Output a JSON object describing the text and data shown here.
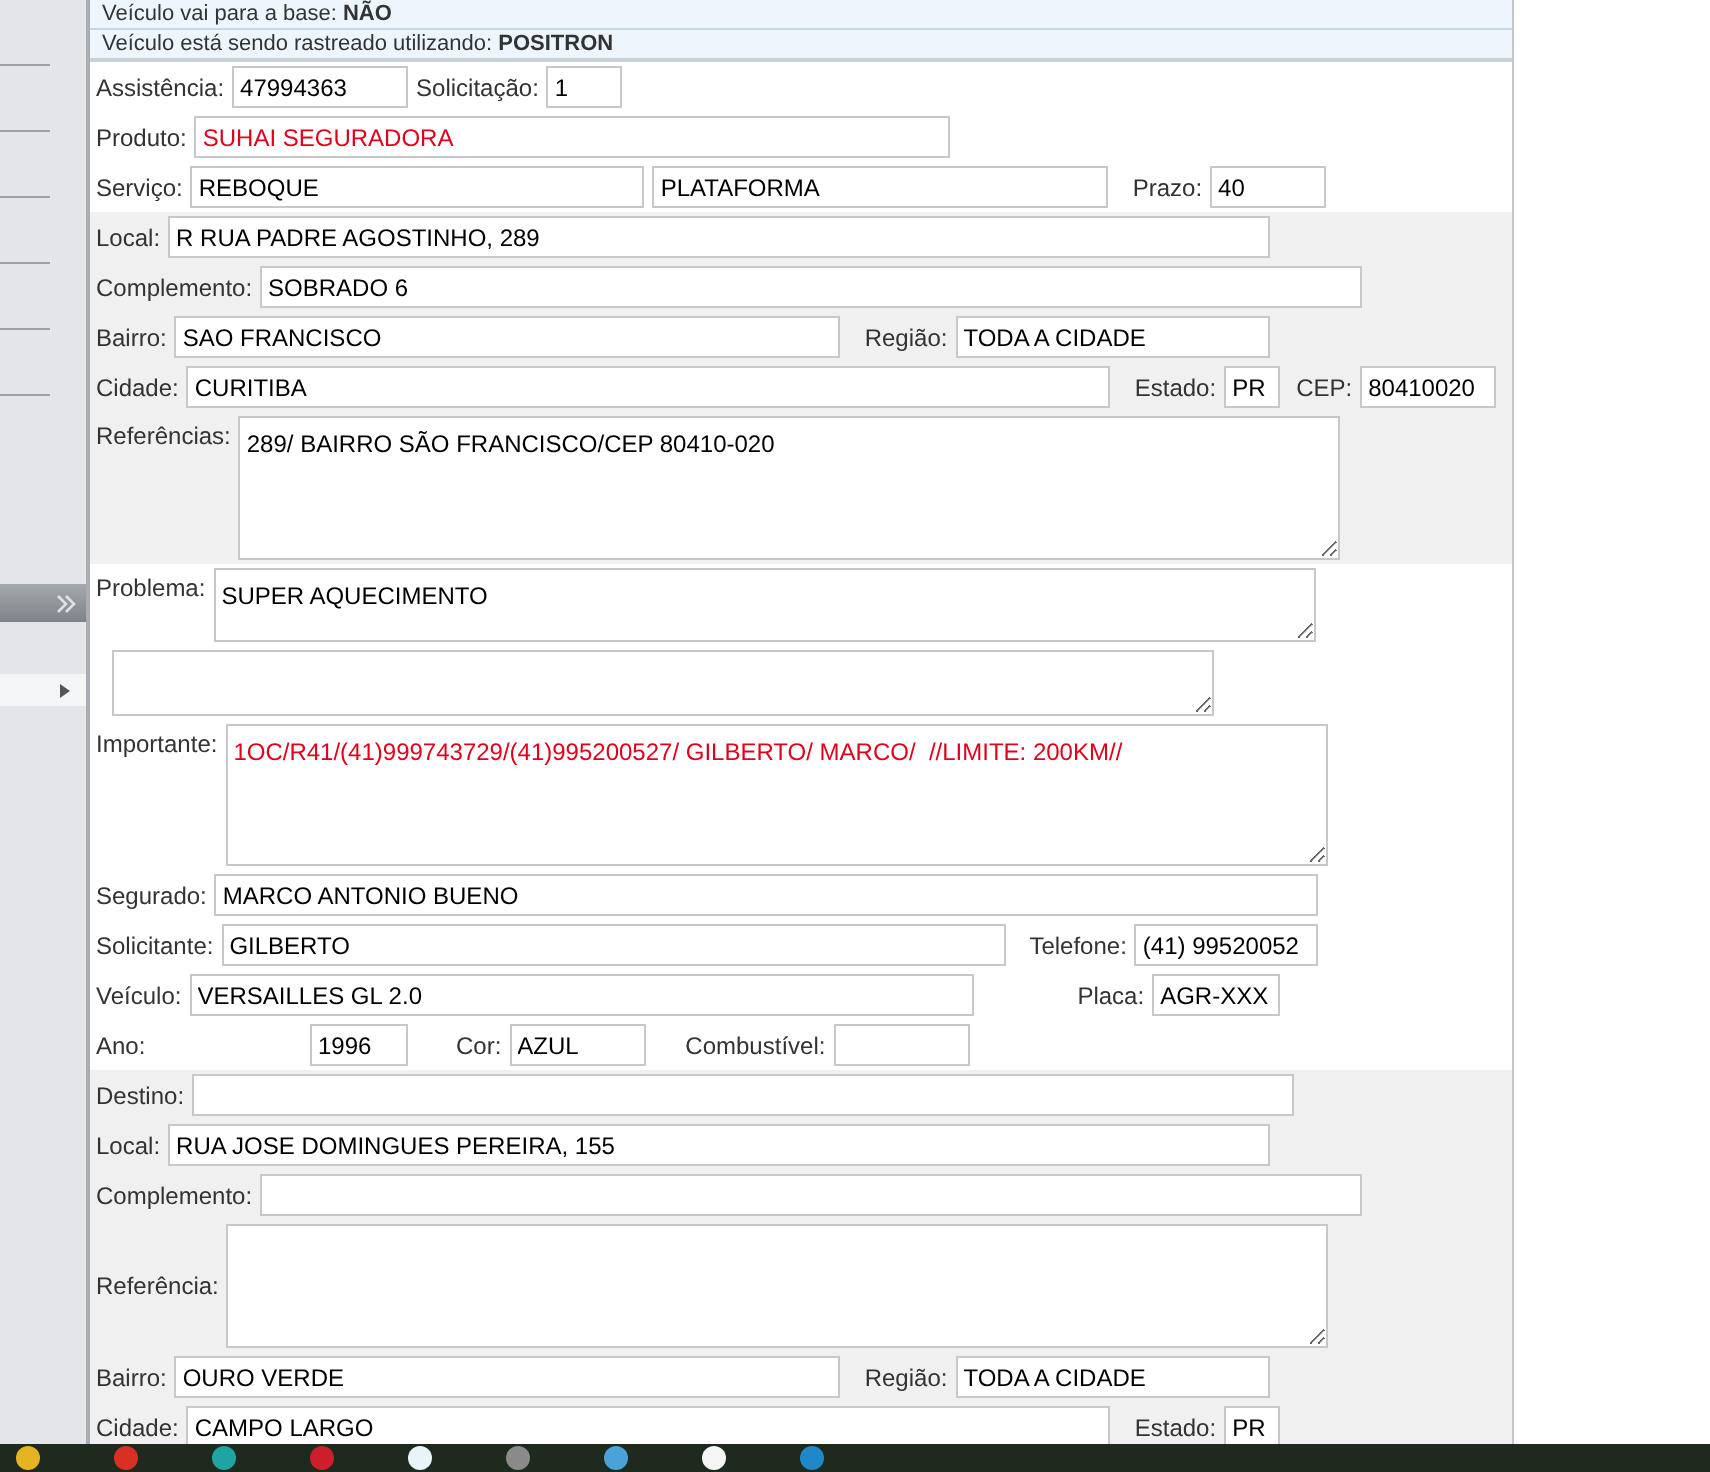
{
  "banners": [
    {
      "text": "Veículo vai para a base: **NÃO**"
    },
    {
      "text": "Veículo está sendo rastreado utilizando: **POSITRON**"
    }
  ],
  "sections": [
    {
      "shaded": false,
      "rows": [
        [
          {
            "label": "Assistência:",
            "value": "47994363",
            "kind": "input",
            "highlighted": false
          },
          {
            "label": "Solicitação:",
            "value": "1",
            "kind": "input",
            "highlighted": false
          }
        ],
        [
          {
            "label": "Produto:",
            "value": "SUHAI SEGURADORA",
            "kind": "input",
            "highlighted": true
          }
        ],
        [
          {
            "label": "Serviço:",
            "value": "REBOQUE",
            "kind": "input",
            "highlighted": false
          },
          {
            "value": "PLATAFORMA",
            "kind": "input",
            "highlighted": false
          },
          {
            "label": "Prazo:",
            "value": "40",
            "kind": "input",
            "highlighted": false
          }
        ]
      ]
    },
    {
      "shaded": true,
      "rows": [
        [
          {
            "label": "Local:",
            "value": "R RUA PADRE AGOSTINHO, 289",
            "kind": "input",
            "highlighted": false
          }
        ],
        [
          {
            "label": "Complemento:",
            "value": "SOBRADO 6",
            "kind": "input",
            "highlighted": false
          }
        ],
        [
          {
            "label": "Bairro:",
            "value": "SAO FRANCISCO",
            "kind": "input",
            "highlighted": false
          },
          {
            "label": "Região:",
            "value": "TODA A CIDADE",
            "kind": "input",
            "highlighted": false
          }
        ],
        [
          {
            "label": "Cidade:",
            "value": "CURITIBA",
            "kind": "input",
            "highlighted": false
          },
          {
            "label": "Estado:",
            "value": "PR",
            "kind": "input",
            "highlighted": false
          },
          {
            "label": "CEP:",
            "value": "80410020",
            "kind": "input",
            "highlighted": false
          }
        ],
        [
          {
            "label": "Referências:",
            "value": "289/ BAIRRO SÃO FRANCISCO/CEP 80410-020",
            "kind": "textarea",
            "highlighted": false
          }
        ]
      ]
    },
    {
      "shaded": false,
      "rows": [
        [
          {
            "label": "Problema:",
            "value": "SUPER AQUECIMENTO",
            "kind": "textarea",
            "highlighted": false
          }
        ],
        [
          {
            "kind": "textarea"
          }
        ],
        [
          {
            "label": "Importante:",
            "value": "1OC/R41/(41)999743729/(41)995200527/ GILBERTO/ MARCO/  //LIMITE: 200KM//",
            "kind": "textarea",
            "highlighted": true
          }
        ],
        [
          {
            "label": "Segurado:",
            "value": "MARCO ANTONIO BUENO",
            "kind": "input",
            "highlighted": false
          }
        ],
        [
          {
            "label": "Solicitante:",
            "value": "GILBERTO",
            "kind": "input",
            "highlighted": false
          },
          {
            "label": "Telefone:",
            "value": "(41) 99520052",
            "kind": "input",
            "highlighted": false
          }
        ],
        [
          {
            "label": "Veículo:",
            "value": "VERSAILLES GL 2.0",
            "kind": "input",
            "highlighted": false
          },
          {
            "label": "Placa:",
            "value": "AGR-XXX",
            "kind": "input",
            "highlighted": false
          }
        ],
        [
          {
            "label": "Ano:",
            "value": "1996",
            "kind": "input",
            "highlighted": false
          },
          {
            "label": "Cor:",
            "value": "AZUL",
            "kind": "input",
            "highlighted": false
          },
          {
            "label": "Combustível:",
            "kind": "input"
          }
        ]
      ]
    },
    {
      "shaded": true,
      "rows": [
        [
          {
            "label": "Destino:",
            "kind": "input"
          }
        ],
        [
          {
            "label": "Local:",
            "value": "RUA JOSE DOMINGUES PEREIRA, 155",
            "kind": "input",
            "highlighted": false
          }
        ],
        [
          {
            "label": "Complemento:",
            "kind": "input"
          }
        ],
        [
          {
            "label": "Referência:",
            "kind": "textarea"
          }
        ],
        [
          {
            "label": "Bairro:",
            "value": "OURO VERDE",
            "kind": "input",
            "highlighted": false
          },
          {
            "label": "Região:",
            "value": "TODA A CIDADE",
            "kind": "input",
            "highlighted": false
          }
        ],
        [
          {
            "label": "Cidade:",
            "value": "CAMPO LARGO",
            "kind": "input",
            "highlighted": false
          },
          {
            "label": "Estado:",
            "value": "PR",
            "kind": "input",
            "highlighted": false
          }
        ]
      ]
    }
  ]
}
